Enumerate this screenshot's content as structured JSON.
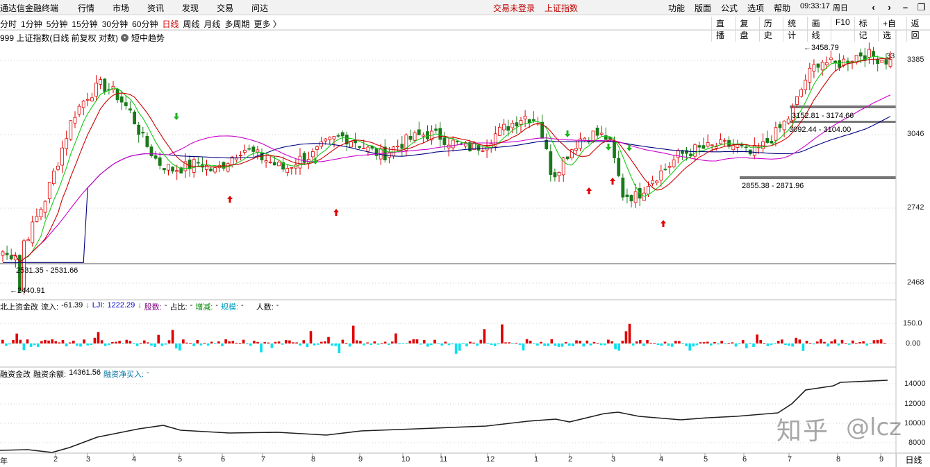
{
  "menubar": {
    "brand": "通达信金融终端",
    "items": [
      "行情",
      "市场",
      "资讯",
      "发现",
      "交易",
      "问达"
    ],
    "status_login": "交易未登录",
    "status_index": "上证指数",
    "right_items": [
      "功能",
      "版面",
      "公式",
      "选项",
      "帮助"
    ],
    "time": "09:33:17",
    "weekday": "周日"
  },
  "toolbar": {
    "periods": [
      "分时",
      "1分钟",
      "5分钟",
      "15分钟",
      "30分钟",
      "60分钟",
      "日线",
      "周线",
      "月线",
      "多周期",
      "更多 〉"
    ],
    "active_period": "日线",
    "tools": [
      "直播",
      "复盘",
      "历史",
      "统计",
      "画线",
      "F10",
      "标记",
      "+自选",
      "返回"
    ]
  },
  "main_panel": {
    "title": "999 上证指数(日线 前复权 对数)",
    "indicator": "短中趋势",
    "y_ticks": [
      "3385",
      "3046",
      "2742",
      "2468"
    ],
    "right_edge_value": "33",
    "high_label": "3458.79",
    "low_label": "2440.91",
    "zones": [
      {
        "label": "3152.81 - 3174.66"
      },
      {
        "label": "3092.44 - 3104.00"
      },
      {
        "label": "2855.38 - 2871.96"
      },
      {
        "label": "2531.35 - 2531.66"
      }
    ]
  },
  "flow_panel": {
    "name": "北上资金改",
    "inflow_label": "流入:",
    "inflow_value": "-61.39",
    "lji_label": "LJI:",
    "lji_value": "1222.29",
    "stocks_label": "股数:",
    "stocks_value": "-",
    "share_label": "占比:",
    "share_value": "-",
    "change_label": "增减:",
    "change_value": "-",
    "scale_label": "规模:",
    "scale_value": "-",
    "people_label": "人数:",
    "people_value": "-",
    "y_ticks": [
      "150.0",
      "0.00"
    ]
  },
  "margin_panel": {
    "name": "融资金改",
    "balance_label": "融资余额:",
    "balance_value": "14361.56",
    "net_label": "融资净买入:",
    "net_value": "-",
    "y_ticks": [
      "14000",
      "12000",
      "10000",
      "8000"
    ]
  },
  "x_axis": {
    "labels": [
      "年",
      "2",
      "3",
      "4",
      "5",
      "6",
      "7",
      "8",
      "9",
      "10",
      "11",
      "12",
      "1",
      "2",
      "3",
      "4",
      "5",
      "6",
      "7",
      "8",
      "9"
    ]
  },
  "bottom_tab": "日线",
  "watermark": {
    "logo": "知乎",
    "handle": "@lcz"
  },
  "colors": {
    "up": "#e00000",
    "down": "#1a7a1a",
    "flow_neg": "#00e0f0",
    "ma_short": "#cc0000",
    "ma_mid": "#11cc11",
    "ma_long": "#cc00cc",
    "ma_base": "#000080",
    "buy_arrow": "#e00000",
    "sell_arrow": "#1db31d"
  },
  "chart_data": {
    "type": "candlestick",
    "y_scale": "log",
    "trend_closes": [
      2560,
      2580,
      2660,
      2780,
      2950,
      3130,
      3220,
      3270,
      3230,
      3150,
      3020,
      2930,
      2900,
      2910,
      2930,
      2890,
      2940,
      2990,
      2960,
      2930,
      2900,
      2940,
      2960,
      3010,
      3040,
      3020,
      2980,
      2960,
      3000,
      3030,
      3050,
      3040,
      3010,
      2990,
      3000,
      3050,
      3090,
      3130,
      3110,
      2870,
      2960,
      3030,
      3050,
      3030,
      2800,
      2790,
      2860,
      2900,
      2960,
      2980,
      2990,
      3000,
      3000,
      2960,
      3000,
      3060,
      3140,
      3300,
      3390,
      3360,
      3390,
      3420,
      3400,
      3380
    ],
    "buy_signals": 5,
    "sell_signals": 4
  }
}
